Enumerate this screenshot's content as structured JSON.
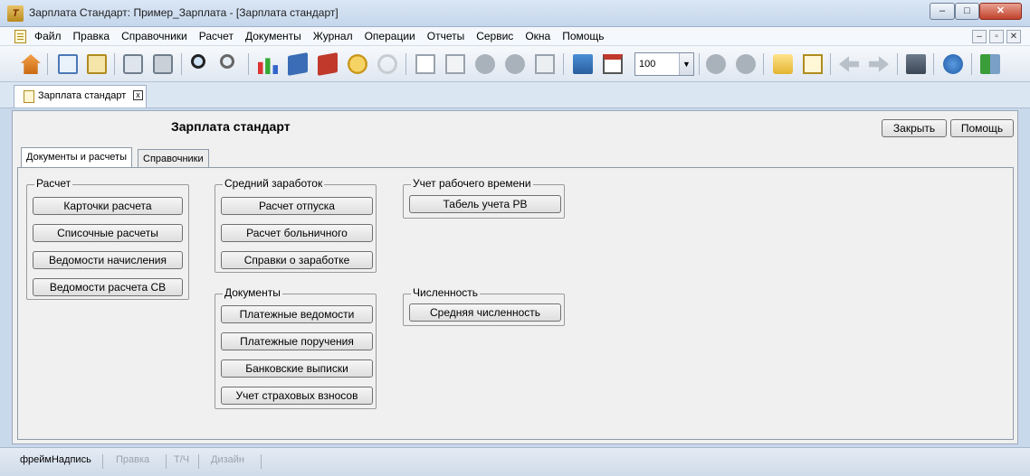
{
  "window": {
    "title": "Зарплата Стандарт: Пример_Зарплата - [Зарплата стандарт]",
    "app_icon_text": "Т",
    "minimize": "–",
    "maximize": "□",
    "close": "✕"
  },
  "menu": {
    "items": [
      "Файл",
      "Правка",
      "Справочники",
      "Расчет",
      "Документы",
      "Журнал",
      "Операции",
      "Отчеты",
      "Сервис",
      "Окна",
      "Помощь"
    ],
    "mdi_min": "–",
    "mdi_restore": "▫",
    "mdi_close": "✕"
  },
  "toolbar": {
    "zoom_value": "100",
    "zoom_arrow": "▼",
    "icons": [
      "home-icon",
      "copy-icon",
      "paste-icon",
      "print-preview-icon",
      "print-icon",
      "search-icon",
      "search-next-icon",
      "chart-icon",
      "book-icon",
      "book-open-icon",
      "coins-icon",
      "disabled-icon",
      "new-doc-icon",
      "copy-doc-icon",
      "check-icon",
      "minus-icon",
      "delete-doc-icon",
      "calculator-icon",
      "calendar-icon",
      "back-icon",
      "forward-icon",
      "folder-icon",
      "note-icon",
      "arrow-left-icon",
      "arrow-right-icon",
      "network-icon",
      "help-icon",
      "exit-icon"
    ]
  },
  "doc_tab": {
    "label": "Зарплата стандарт",
    "close": "x"
  },
  "main": {
    "title": "Зарплата стандарт",
    "close_button": "Закрыть",
    "help_button": "Помощь",
    "tabs": [
      {
        "label": "Документы и расчеты",
        "active": true
      },
      {
        "label": "Справочники",
        "active": false
      }
    ],
    "groups": {
      "raschet": {
        "title": "Расчет",
        "buttons": [
          "Карточки расчета",
          "Списочные расчеты",
          "Ведомости начисления",
          "Ведомости расчета СВ"
        ]
      },
      "sredniy": {
        "title": "Средний заработок",
        "buttons": [
          "Расчет отпуска",
          "Расчет больничного",
          "Справки о заработке"
        ]
      },
      "uchet": {
        "title": "Учет рабочего времени",
        "buttons": [
          "Табель учета РВ"
        ]
      },
      "dokumenty": {
        "title": "Документы",
        "buttons": [
          "Платежные ведомости",
          "Платежные поручения",
          "Банковские выписки",
          "Учет страховых взносов"
        ]
      },
      "chislennost": {
        "title": "Численность",
        "buttons": [
          "Средняя численность"
        ]
      }
    }
  },
  "status": {
    "items": [
      {
        "label": "фреймНадпись",
        "enabled": true
      },
      {
        "label": "Правка",
        "enabled": false
      },
      {
        "label": "Т/Ч",
        "enabled": false
      },
      {
        "label": "Дизайн",
        "enabled": false
      }
    ]
  }
}
